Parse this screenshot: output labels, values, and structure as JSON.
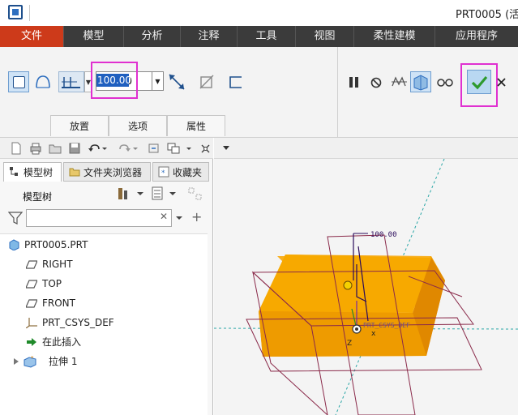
{
  "titlebar": {
    "title": "PRT0005 (活"
  },
  "menu": [
    "文件",
    "模型",
    "分析",
    "注释",
    "工具",
    "视图",
    "柔性建模",
    "应用程序"
  ],
  "ribbon": {
    "depth_value": "100.00",
    "tabs": [
      "放置",
      "选项",
      "属性"
    ],
    "highlight_color": "#e030d0"
  },
  "panel": {
    "tabs": [
      "模型树",
      "文件夹浏览器",
      "收藏夹"
    ],
    "tree_label": "模型树",
    "filter_placeholder": "",
    "tree": [
      {
        "label": "PRT0005.PRT",
        "icon": "part-icon"
      },
      {
        "label": "RIGHT",
        "icon": "datum-plane-icon"
      },
      {
        "label": "TOP",
        "icon": "datum-plane-icon"
      },
      {
        "label": "FRONT",
        "icon": "datum-plane-icon"
      },
      {
        "label": "PRT_CSYS_DEF",
        "icon": "csys-icon"
      },
      {
        "label": "在此插入",
        "icon": "insert-arrow-icon"
      },
      {
        "label": "拉伸 1",
        "icon": "extrude-icon"
      }
    ]
  },
  "viewport": {
    "dim_label": "100.00",
    "csys_label": "PRT_CSYS_DEF",
    "axis_label": "Z",
    "block_color": "#f5a000"
  },
  "colors": {
    "menubar": "#3b3b3b",
    "active_menu": "#cd3a1a",
    "accent": "#1f5fbf"
  }
}
